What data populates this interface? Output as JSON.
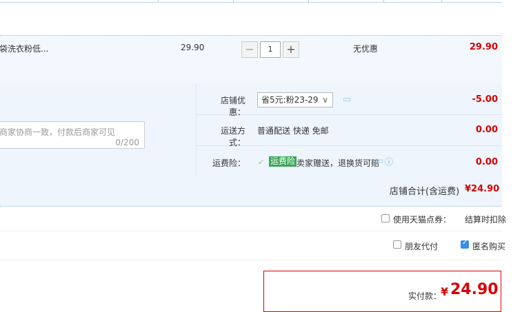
{
  "product": {
    "name": "袋洗衣粉低...",
    "unit_price": "29.90",
    "quantity": "1",
    "discount": "无优惠",
    "subtotal": "29.90"
  },
  "shop_options": {
    "discount_label": "店铺优惠：",
    "discount_select": "省5元:粉23-29",
    "discount_amount": "-5.00",
    "shipping_label": "运送方式：",
    "shipping_value": "普通配送 快递 免邮",
    "shipping_amount": "0.00",
    "insurance_label": "运费险：",
    "insurance_badge": "运费险",
    "insurance_text": "卖家赠送，退换货可赔",
    "insurance_amount": "0.00"
  },
  "message": {
    "placeholder": "商家协商一致，付款后商家可见",
    "counter": "0/200"
  },
  "shop_total": {
    "label": "店铺合计(含运费)",
    "value": "¥24.90"
  },
  "tmall_points": {
    "label": "使用天猫点券：",
    "note": "结算时扣除"
  },
  "footer_options": {
    "friend_pay": "朋友代付",
    "anonymous": "匿名购买"
  },
  "payment": {
    "label": "实付款：",
    "currency": "¥",
    "amount": "24.90"
  },
  "colors": {
    "accent_red": "#d60000",
    "accent_blue": "#3a8ee6",
    "badge_green": "#3aa655"
  }
}
